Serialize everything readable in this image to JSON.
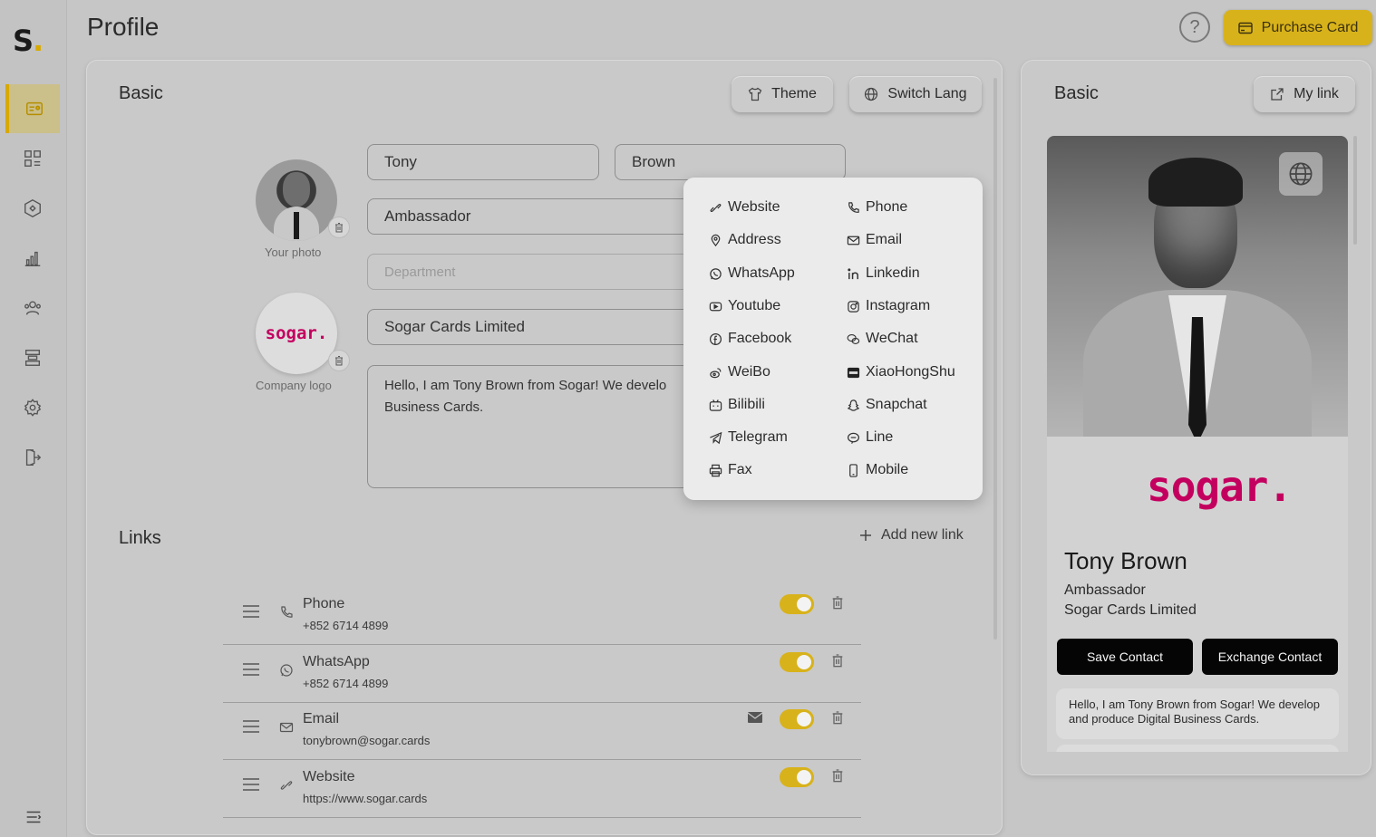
{
  "app": {
    "logo_letter": "S",
    "logo_dot": "."
  },
  "header": {
    "title": "Profile",
    "help_label": "?",
    "purchase_label": "Purchase Card"
  },
  "sidebar": {
    "items": [
      {
        "name": "sidebar-item-profile",
        "icon": "id-card-icon",
        "active": true
      },
      {
        "name": "sidebar-item-dashboard",
        "icon": "grid-icon",
        "active": false
      },
      {
        "name": "sidebar-item-cards",
        "icon": "hexagon-icon",
        "active": false
      },
      {
        "name": "sidebar-item-analytics",
        "icon": "bar-chart-icon",
        "active": false
      },
      {
        "name": "sidebar-item-contacts",
        "icon": "users-icon",
        "active": false
      },
      {
        "name": "sidebar-item-templates",
        "icon": "layers-icon",
        "active": false
      },
      {
        "name": "sidebar-item-settings",
        "icon": "gear-icon",
        "active": false
      },
      {
        "name": "sidebar-item-logout",
        "icon": "logout-icon",
        "active": false
      }
    ]
  },
  "basic": {
    "title": "Basic",
    "theme_label": "Theme",
    "switch_lang_label": "Switch Lang",
    "photo_caption": "Your photo",
    "logo_caption": "Company logo",
    "company_logo_text": "sogar.",
    "first_name": "Tony",
    "last_name": "Brown",
    "job_title": "Ambassador",
    "department_placeholder": "Department",
    "company": "Sogar Cards Limited",
    "bio_line1": "Hello, I am Tony Brown from Sogar!  We develo",
    "bio_line2": "Business Cards."
  },
  "link_menu": {
    "left": [
      "Website",
      "Address",
      "WhatsApp",
      "Youtube",
      "Facebook",
      "WeiBo",
      "Bilibili",
      "Telegram",
      "Fax"
    ],
    "right": [
      "Phone",
      "Email",
      "Linkedin",
      "Instagram",
      "WeChat",
      "XiaoHongShu",
      "Snapchat",
      "Line",
      "Mobile"
    ]
  },
  "links": {
    "title": "Links",
    "add_label": "Add new link",
    "rows": [
      {
        "title": "Phone",
        "value": "+852 6714 4899",
        "enabled": true
      },
      {
        "title": "WhatsApp",
        "value": "+852 6714 4899",
        "enabled": true
      },
      {
        "title": "Email",
        "value": "tonybrown@sogar.cards",
        "enabled": true
      },
      {
        "title": "Website",
        "value": "https://www.sogar.cards",
        "enabled": true
      }
    ]
  },
  "preview": {
    "title": "Basic",
    "my_link_label": "My link",
    "logo_text": "sogar.",
    "name": "Tony Brown",
    "role": "Ambassador",
    "company": "Sogar Cards Limited",
    "save_label": "Save Contact",
    "exchange_label": "Exchange Contact",
    "bio": "Hello, I am Tony Brown from Sogar! We develop and produce Digital Business Cards."
  },
  "colors": {
    "accent": "#d8b21a",
    "brand_pink": "#c4005f",
    "background": "#c6c6c6"
  }
}
